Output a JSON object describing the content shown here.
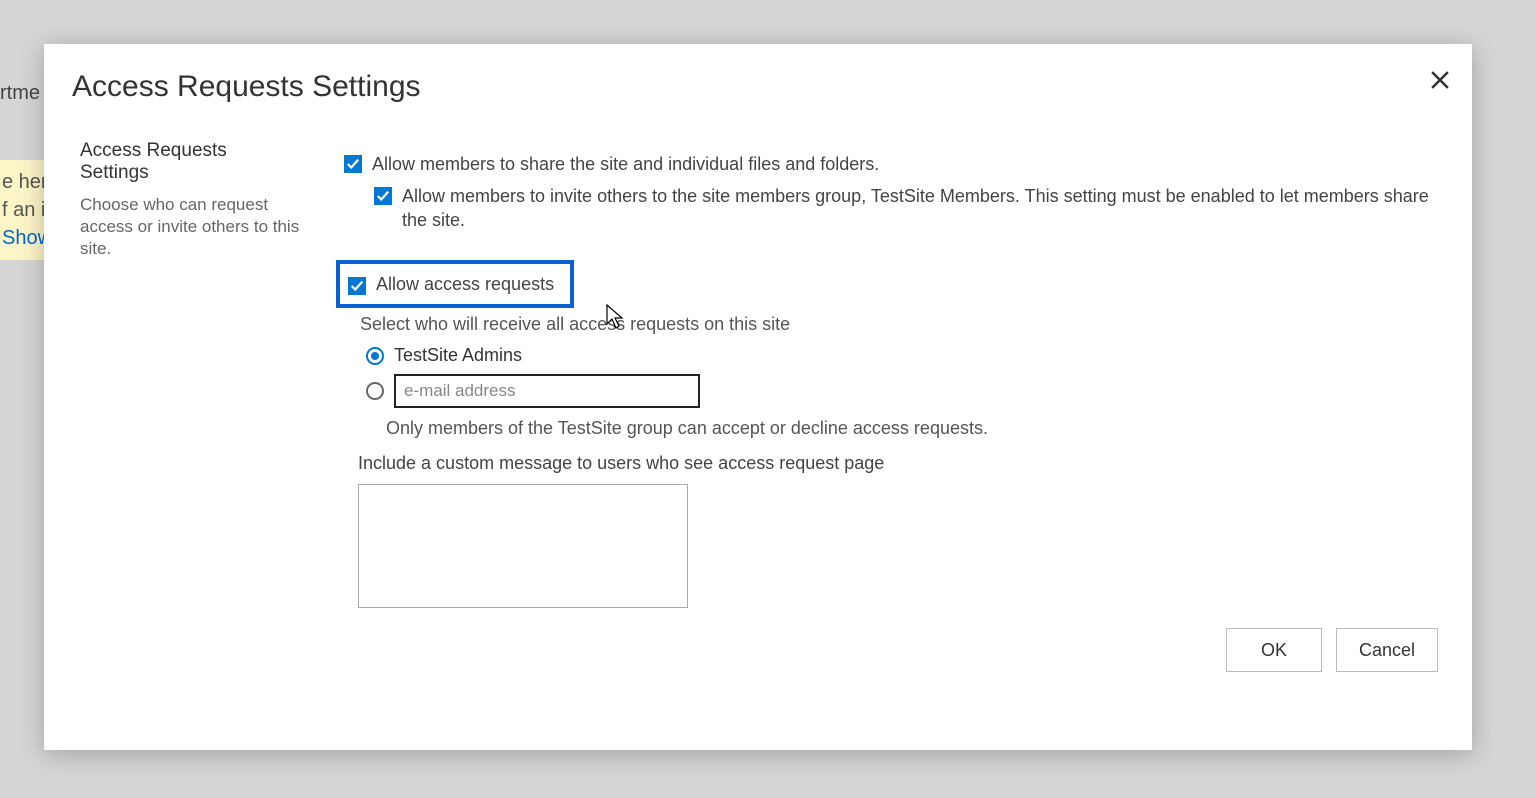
{
  "background": {
    "nav_fragment": "rtme",
    "banner_line1": "e her",
    "banner_line2": "f an it",
    "banner_line3": "Show"
  },
  "modal": {
    "title": "Access Requests Settings",
    "section_heading": "Access Requests Settings",
    "section_desc": "Choose who can request access or invite others to this site.",
    "checkboxes": {
      "allow_share": {
        "label": "Allow members to share the site and individual files and folders.",
        "checked": true
      },
      "allow_invite": {
        "label": "Allow members to invite others to the site members group, TestSite Members. This setting must be enabled to let members share the site.",
        "checked": true
      },
      "allow_access_requests": {
        "label": "Allow access requests",
        "checked": true
      }
    },
    "select_recipient_label": "Select who will receive all access requests on this site",
    "radios": {
      "admins": {
        "label": "TestSite Admins",
        "selected": true
      },
      "email": {
        "placeholder": "e-mail address",
        "selected": false,
        "value": ""
      }
    },
    "note": "Only members of the TestSite group can accept or decline access requests.",
    "custom_msg_label": "Include a custom message to users who see access request page",
    "custom_msg_value": "",
    "buttons": {
      "ok": "OK",
      "cancel": "Cancel"
    }
  }
}
